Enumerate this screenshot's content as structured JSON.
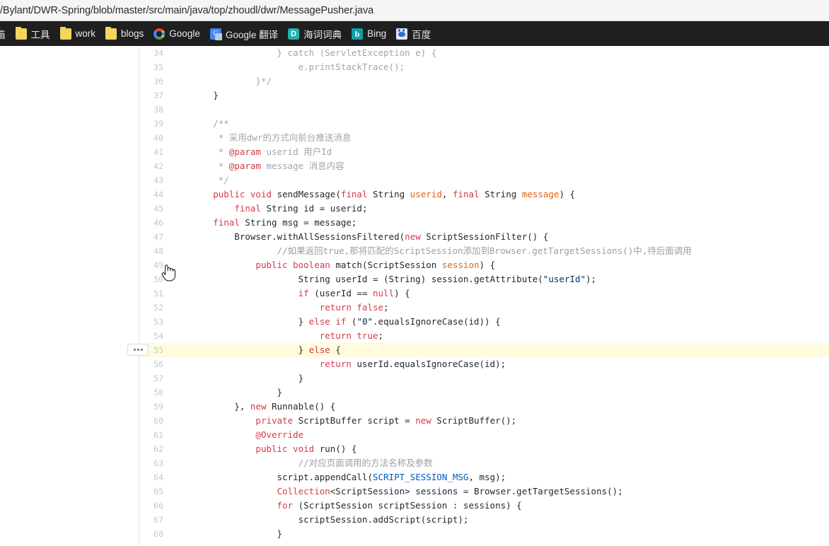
{
  "urlbar": {
    "url": "/Bylant/DWR-Spring/blob/master/src/main/java/top/zhoudl/dwr/MessagePusher.java"
  },
  "bookmarks": [
    {
      "label": "箱",
      "icon": "mail-folder-icon"
    },
    {
      "label": "工具",
      "icon": "folder-icon"
    },
    {
      "label": "work",
      "icon": "folder-icon"
    },
    {
      "label": "blogs",
      "icon": "folder-icon"
    },
    {
      "label": "Google",
      "icon": "google-icon"
    },
    {
      "label": "Google 翻译",
      "icon": "google-translate-icon"
    },
    {
      "label": "海词词典",
      "icon": "dict-icon",
      "glyph": "D"
    },
    {
      "label": "Bing",
      "icon": "bing-icon",
      "glyph": "b"
    },
    {
      "label": "百度",
      "icon": "baidu-icon"
    }
  ],
  "editor": {
    "expand_button_label": "expand-hidden-lines",
    "highlighted_line": 55,
    "lines": [
      {
        "n": 34,
        "html": "                    <span class=\"cm\">} catch (ServletException e) {</span>"
      },
      {
        "n": 35,
        "html": "                        <span class=\"cm\">e.printStackTrace();</span>"
      },
      {
        "n": 36,
        "html": "                <span class=\"cm\">}*/</span>"
      },
      {
        "n": 37,
        "html": "        }"
      },
      {
        "n": 38,
        "html": ""
      },
      {
        "n": 39,
        "html": "        <span class=\"cm\">/**</span>"
      },
      {
        "n": 40,
        "html": "         <span class=\"cm\">* 采用dwr的方式向前台推送消息</span>"
      },
      {
        "n": 41,
        "html": "         <span class=\"cm\">* <span class=\"tg\">@param</span> userid 用户Id</span>"
      },
      {
        "n": 42,
        "html": "         <span class=\"cm\">* <span class=\"tg\">@param</span> message 消息内容</span>"
      },
      {
        "n": 43,
        "html": "         <span class=\"cm\">*/</span>"
      },
      {
        "n": 44,
        "html": "        <span class=\"k\">public</span> <span class=\"k\">void</span> sendMessage(<span class=\"k\">final</span> String <span class=\"pn\">userid</span>, <span class=\"k\">final</span> String <span class=\"pn\">message</span>) {"
      },
      {
        "n": 45,
        "html": "            <span class=\"k\">final</span> String id = userid;"
      },
      {
        "n": 46,
        "html": "        <span class=\"k\">final</span> String msg = message;"
      },
      {
        "n": 47,
        "html": "            Browser.withAllSessionsFiltered(<span class=\"k\">new</span> ScriptSessionFilter() {"
      },
      {
        "n": 48,
        "html": "                    <span class=\"cm2\">//如果返回true,那将匹配的ScriptSession添加到Browser.getTargetSessions()中,待后面调用</span>"
      },
      {
        "n": 49,
        "html": "                <span class=\"k\">public</span> <span class=\"k\">boolean</span> match(ScriptSession <span class=\"pn\">session</span>) {"
      },
      {
        "n": 50,
        "html": "                        String userId = (String) session.getAttribute(<span class=\"st\">\"userId\"</span>);"
      },
      {
        "n": 51,
        "html": "                        <span class=\"k\">if</span> (userId == <span class=\"k\">null</span>) {"
      },
      {
        "n": 52,
        "html": "                            <span class=\"k\">return</span> <span class=\"k\">false</span>;"
      },
      {
        "n": 53,
        "html": "                        } <span class=\"k\">else</span> <span class=\"k\">if</span> (<span class=\"st\">\"0\"</span>.equalsIgnoreCase(id)) {"
      },
      {
        "n": 54,
        "html": "                            <span class=\"k\">return</span> <span class=\"k\">true</span>;"
      },
      {
        "n": 55,
        "html": "                        } <span class=\"k\">else</span> {"
      },
      {
        "n": 56,
        "html": "                            <span class=\"k\">return</span> userId.equalsIgnoreCase(id);"
      },
      {
        "n": 57,
        "html": "                        }"
      },
      {
        "n": 58,
        "html": "                    }"
      },
      {
        "n": 59,
        "html": "            }, <span class=\"k\">new</span> Runnable() {"
      },
      {
        "n": 60,
        "html": "                <span class=\"k\">private</span> ScriptBuffer script = <span class=\"k\">new</span> ScriptBuffer();"
      },
      {
        "n": 61,
        "html": "                <span class=\"k\">@Override</span>"
      },
      {
        "n": 62,
        "html": "                <span class=\"k\">public</span> <span class=\"k\">void</span> run() {"
      },
      {
        "n": 63,
        "html": "                        <span class=\"cm2\">//对应页面调用的方法名称及参数</span>"
      },
      {
        "n": 64,
        "html": "                    script.appendCall(<span class=\"cn\">SCRIPT_SESSION_MSG</span>, msg);"
      },
      {
        "n": 65,
        "html": "                    <span class=\"k\">Collection</span>&lt;ScriptSession&gt; sessions = Browser.getTargetSessions();"
      },
      {
        "n": 66,
        "html": "                    <span class=\"k\">for</span> (ScriptSession scriptSession : sessions) {"
      },
      {
        "n": 67,
        "html": "                        scriptSession.addScript(script);"
      },
      {
        "n": 68,
        "html": "                    }"
      }
    ]
  },
  "colors": {
    "bookmark_bar_bg": "#1f1f1f",
    "highlight_line_bg": "#fffbdd",
    "keyword": "#d73a49",
    "comment": "#a0a6ad",
    "string": "#032f62",
    "constant": "#005cc5",
    "param": "#e36209",
    "line_number": "#c3c8ce"
  }
}
